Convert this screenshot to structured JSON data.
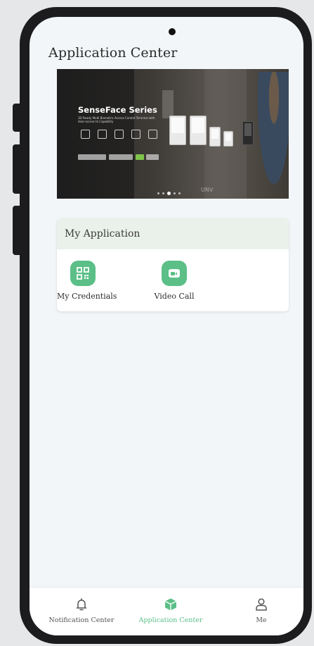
{
  "header": {
    "title": "Application Center"
  },
  "banner": {
    "headline": "SenseFace Series",
    "subtitle": "3D Ready Multi Biometric Access Control Terminal with door-access to Capability",
    "logo_text": "UNV",
    "slide_count": 5,
    "active_slide": 3
  },
  "my_application": {
    "section_title": "My Application",
    "apps": [
      {
        "label": "My Credentials",
        "icon": "qr-code-icon"
      },
      {
        "label": "Video Call",
        "icon": "video-camera-icon"
      }
    ]
  },
  "tabbar": {
    "tabs": [
      {
        "label": "Notification Center",
        "icon": "bell-icon",
        "active": false
      },
      {
        "label": "Application Center",
        "icon": "cube-icon",
        "active": true
      },
      {
        "label": "Me",
        "icon": "user-icon",
        "active": false
      }
    ]
  },
  "colors": {
    "accent": "#5bbf87",
    "header_bg": "#eaf1ea",
    "inactive": "#555555"
  }
}
